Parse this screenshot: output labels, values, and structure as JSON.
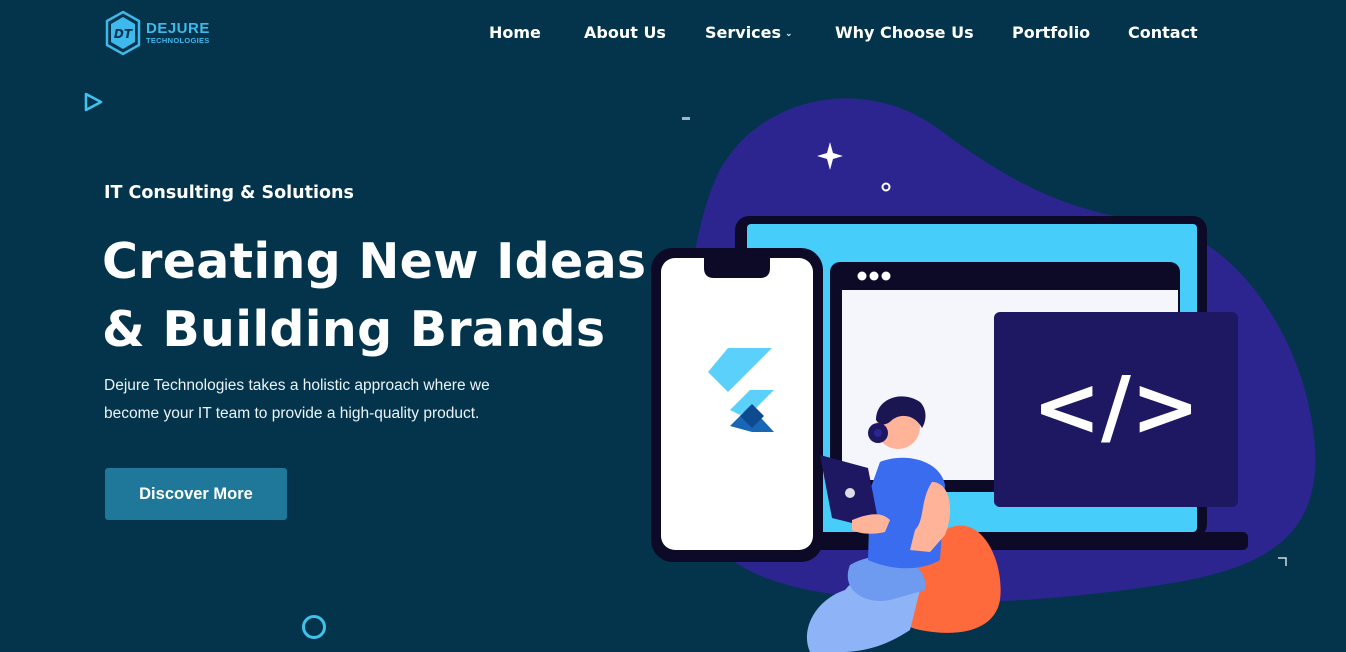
{
  "brand": {
    "name": "DEJURE",
    "subtitle": "TECHNOLOGIES",
    "mark_letters": "DT",
    "accent_color": "#3fb8ec"
  },
  "nav": {
    "items": [
      {
        "label": "Home",
        "has_dropdown": false
      },
      {
        "label": "About Us",
        "has_dropdown": false
      },
      {
        "label": "Services",
        "has_dropdown": true
      },
      {
        "label": "Why Choose Us",
        "has_dropdown": false
      },
      {
        "label": "Portfolio",
        "has_dropdown": false
      },
      {
        "label": "Contact",
        "has_dropdown": false
      }
    ],
    "dropdown_glyph": "⌄"
  },
  "hero": {
    "eyebrow": "IT Consulting & Solutions",
    "headline_line1": "Creating New Ideas",
    "headline_line2": "& Building Brands",
    "description_line1": "Dejure Technologies takes a holistic approach where we",
    "description_line2": "become your IT team to provide a high-quality product.",
    "cta_label": "Discover More"
  },
  "illustration": {
    "code_symbol": "</>",
    "icons": [
      "flutter-logo-icon",
      "code-brackets-icon",
      "gear-icon",
      "sparkle-icon",
      "laptop-icon"
    ]
  },
  "colors": {
    "background": "#03344c",
    "blob": "#2c2590",
    "screen_cyan": "#47cdf9",
    "dark_panel": "#1e1762",
    "button": "#1f7799",
    "orange": "#ff6a3d"
  }
}
